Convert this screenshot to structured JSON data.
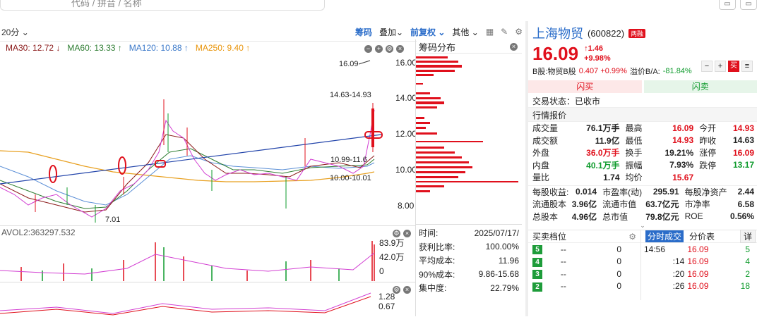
{
  "search": {
    "placeholder": "代码 / 拼音 / 名称"
  },
  "toolbar": {
    "period": "20分",
    "chip": "筹码",
    "overlay": "叠加",
    "adjust": "前复权",
    "other": "其他"
  },
  "ma": [
    {
      "label": "MA30: 12.72 ↓",
      "color": "#8b1a1a"
    },
    {
      "label": "MA60: 13.33 ↑",
      "color": "#2e7d32"
    },
    {
      "label": "MA120: 10.88 ↑",
      "color": "#3a78c9"
    },
    {
      "label": "MA250: 9.40 ↑",
      "color": "#e8940a"
    }
  ],
  "price_axis": [
    "16.00",
    "14.00",
    "12.00",
    "10.00",
    "8.00"
  ],
  "annotations": {
    "high": "16.09",
    "range1": "14.63-14.93",
    "range2": "10.99-11.6",
    "range3": "10.00-10.01",
    "low": "7.01"
  },
  "vol": {
    "label": "AVOL2:363297.532",
    "axis": [
      "83.9万",
      "42.0万",
      "0"
    ]
  },
  "sub": {
    "axis": [
      "1.28",
      "0.67"
    ]
  },
  "chip_panel": {
    "title": "筹码分布",
    "rows": [
      {
        "k": "时间:",
        "v": "2025/07/17/"
      },
      {
        "k": "获利比率:",
        "v": "100.00%"
      },
      {
        "k": "平均成本:",
        "v": "11.96"
      },
      {
        "k": "90%成本:",
        "v": "9.86-15.68"
      },
      {
        "k": "集中度:",
        "v": "22.79%"
      }
    ]
  },
  "quote": {
    "name": "上海物贸",
    "code": "(600822)",
    "badge": "两融",
    "price": "16.09",
    "change": "↑1.46",
    "change_pct": "+9.98%",
    "bshare_label": "B股:物贸B股",
    "bshare_value": "0.407 +0.99%",
    "premium_label": "溢价B/A:",
    "premium_value": "-81.84%",
    "flash_buy": "闪买",
    "flash_sell": "闪卖",
    "status": "交易状态：已收市",
    "section": "行情报价"
  },
  "stats": [
    [
      {
        "k": "成交量",
        "v": "76.1万手",
        "c": ""
      },
      {
        "k": "最高",
        "v": "16.09",
        "c": "red"
      },
      {
        "k": "今开",
        "v": "14.93",
        "c": "red"
      }
    ],
    [
      {
        "k": "成交额",
        "v": "11.9亿",
        "c": ""
      },
      {
        "k": "最低",
        "v": "14.93",
        "c": "red"
      },
      {
        "k": "昨收",
        "v": "14.63",
        "c": ""
      }
    ],
    [
      {
        "k": "外盘",
        "v": "36.0万手",
        "c": "red"
      },
      {
        "k": "换手",
        "v": "19.21%",
        "c": ""
      },
      {
        "k": "涨停",
        "v": "16.09",
        "c": "red"
      }
    ],
    [
      {
        "k": "内盘",
        "v": "40.1万手",
        "c": "green"
      },
      {
        "k": "振幅",
        "v": "7.93%",
        "c": ""
      },
      {
        "k": "跌停",
        "v": "13.17",
        "c": "green"
      }
    ],
    [
      {
        "k": "量比",
        "v": "1.74",
        "c": ""
      },
      {
        "k": "均价",
        "v": "15.67",
        "c": "red"
      },
      {
        "k": "",
        "v": "",
        "c": ""
      }
    ]
  ],
  "fundamentals": [
    [
      {
        "k": "每股收益:",
        "v": "0.014"
      },
      {
        "k": "市盈率(动)",
        "v": "295.91"
      },
      {
        "k": "每股净资产",
        "v": "2.44"
      }
    ],
    [
      {
        "k": "流通股本",
        "v": "3.96亿"
      },
      {
        "k": "流通市值",
        "v": "63.7亿元"
      },
      {
        "k": "市净率",
        "v": "6.58"
      }
    ],
    [
      {
        "k": "总股本",
        "v": "4.96亿"
      },
      {
        "k": "总市值",
        "v": "79.8亿元"
      },
      {
        "k": "ROE",
        "v": "0.56%"
      }
    ]
  ],
  "orderbook": {
    "title": "买卖档位",
    "rows": [
      {
        "n": "5",
        "p": "--",
        "q": "0"
      },
      {
        "n": "4",
        "p": "--",
        "q": "0"
      },
      {
        "n": "3",
        "p": "--",
        "q": "0"
      },
      {
        "n": "2",
        "p": "--",
        "q": "0"
      }
    ]
  },
  "ticks": {
    "tab_active": "分时成交",
    "tab_other": "分价表",
    "detail": "详",
    "rows": [
      {
        "t": "14:56",
        "p": "16.09",
        "v": "5"
      },
      {
        "t": ":14",
        "p": "16.09",
        "v": "4"
      },
      {
        "t": ":20",
        "p": "16.09",
        "v": "2"
      },
      {
        "t": ":26",
        "p": "16.09",
        "v": "18"
      }
    ]
  },
  "colors": {
    "up": "#e0101c",
    "down": "#0f9b2d",
    "accent": "#2a6cc9"
  }
}
